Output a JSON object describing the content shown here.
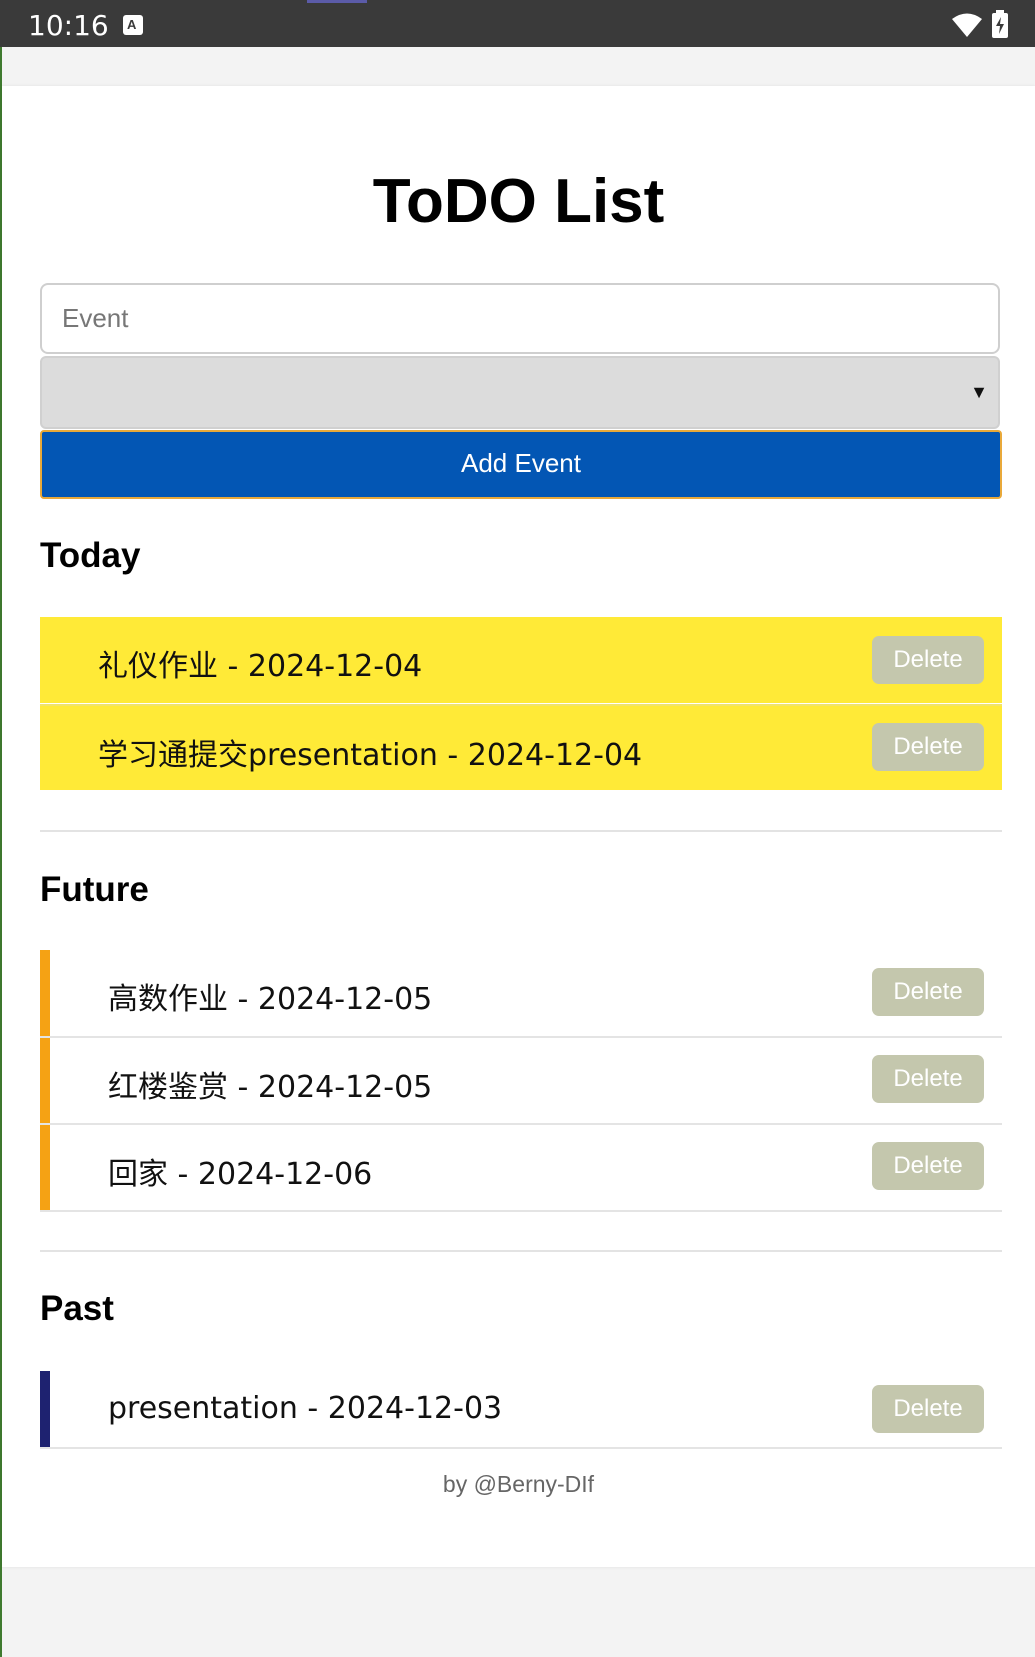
{
  "status_bar": {
    "time": "10:16",
    "keyboard_icon_letter": "A"
  },
  "app": {
    "title": "ToDO List",
    "event_input": {
      "placeholder": "Event",
      "value": ""
    },
    "date_select": {
      "value": ""
    },
    "add_button_label": "Add Event",
    "delete_label": "Delete",
    "footer": "by @Berny-DIf"
  },
  "sections": {
    "today": {
      "heading": "Today",
      "items": [
        {
          "text": "礼仪作业 - 2024-12-04"
        },
        {
          "text": "学习通提交presentation - 2024-12-04"
        }
      ]
    },
    "future": {
      "heading": "Future",
      "items": [
        {
          "text": "高数作业 - 2024-12-05"
        },
        {
          "text": "红楼鉴赏 - 2024-12-05"
        },
        {
          "text": "回家 - 2024-12-06"
        }
      ]
    },
    "past": {
      "heading": "Past",
      "items": [
        {
          "text": "presentation - 2024-12-03"
        }
      ]
    }
  },
  "colors": {
    "today_bg": "#ffea37",
    "future_accent": "#f5a214",
    "past_accent": "#1e2270",
    "add_button": "#0356b4",
    "delete_button": "#c4c7ad"
  },
  "icons": [
    "wifi-icon",
    "battery-charging-icon",
    "keyboard-a-icon",
    "dropdown-caret-icon"
  ]
}
